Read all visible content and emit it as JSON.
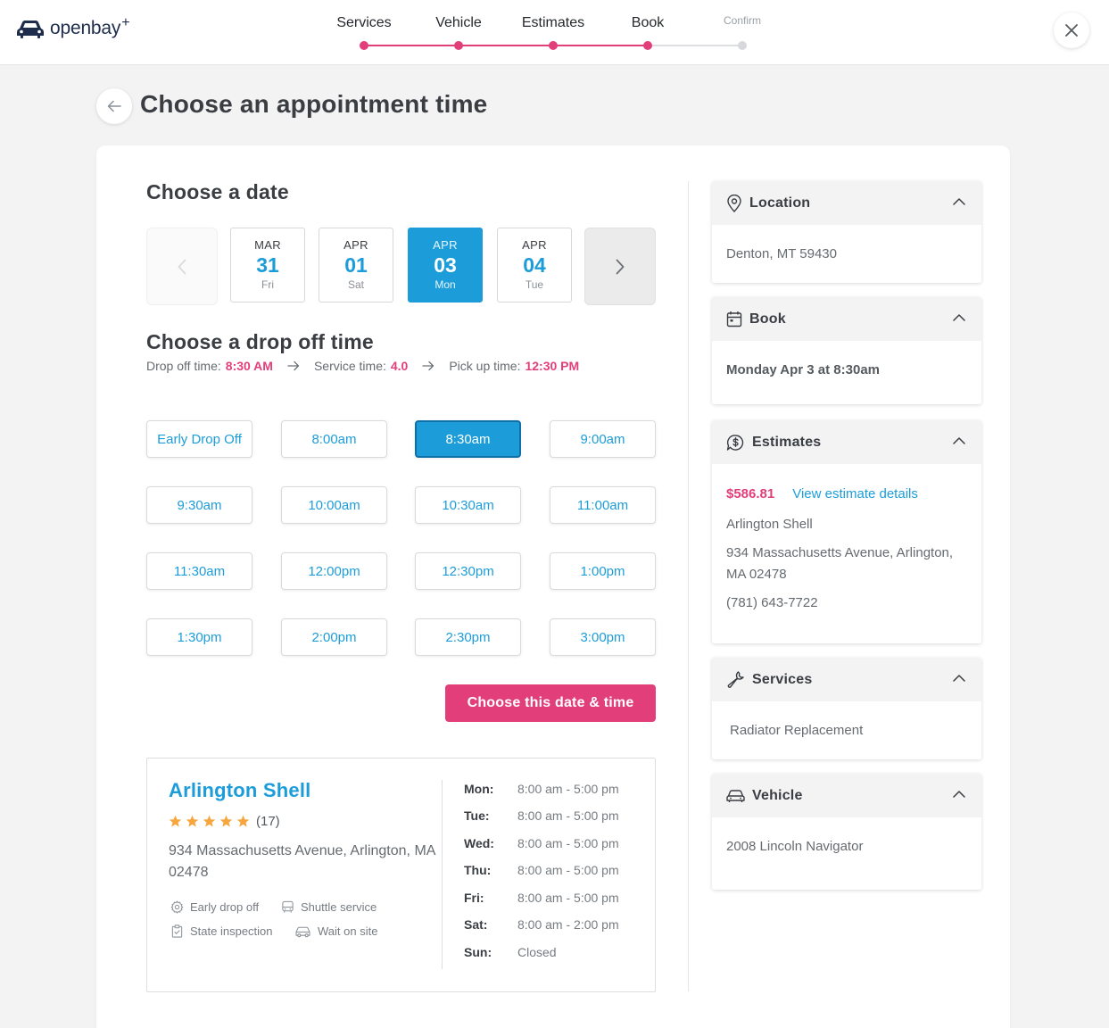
{
  "header": {
    "logo_text": "openbay",
    "logo_plus": "+",
    "steps": [
      {
        "label": "Services",
        "active": true
      },
      {
        "label": "Vehicle",
        "active": true
      },
      {
        "label": "Estimates",
        "active": true
      },
      {
        "label": "Book",
        "active": true
      },
      {
        "label": "Confirm",
        "active": false
      }
    ],
    "accent_color": "#e23f7a"
  },
  "page": {
    "title": "Choose an appointment time"
  },
  "date_section": {
    "heading": "Choose a date",
    "dates": [
      {
        "month": "MAR",
        "day": "31",
        "weekday": "Fri",
        "selected": false
      },
      {
        "month": "APR",
        "day": "01",
        "weekday": "Sat",
        "selected": false
      },
      {
        "month": "APR",
        "day": "03",
        "weekday": "Mon",
        "selected": true
      },
      {
        "month": "APR",
        "day": "04",
        "weekday": "Tue",
        "selected": false
      }
    ]
  },
  "time_section": {
    "heading": "Choose a drop off time",
    "drop_off_label": "Drop off time:",
    "drop_off_value": "8:30 AM",
    "service_label": "Service time:",
    "service_value": "4.0",
    "pickup_label": "Pick up time:",
    "pickup_value": "12:30 PM",
    "slots": [
      "Early Drop Off",
      "8:00am",
      "8:30am",
      "9:00am",
      "9:30am",
      "10:00am",
      "10:30am",
      "11:00am",
      "11:30am",
      "12:00pm",
      "12:30pm",
      "1:00pm",
      "1:30pm",
      "2:00pm",
      "2:30pm",
      "3:00pm"
    ],
    "selected_slot": "8:30am",
    "cta_label": "Choose this date & time"
  },
  "shop": {
    "name": "Arlington Shell",
    "rating": 5,
    "review_count": "(17)",
    "address": "934 Massachusetts Avenue, Arlington, MA 02478",
    "amenities": [
      {
        "icon": "gear-icon",
        "label": "Early drop off"
      },
      {
        "icon": "bus-icon",
        "label": "Shuttle service"
      },
      {
        "icon": "clipboard-check-icon",
        "label": "State inspection"
      },
      {
        "icon": "car-wait-icon",
        "label": "Wait on site"
      }
    ],
    "hours": [
      {
        "day": "Mon:",
        "hours": "8:00 am - 5:00 pm"
      },
      {
        "day": "Tue:",
        "hours": "8:00 am - 5:00 pm"
      },
      {
        "day": "Wed:",
        "hours": "8:00 am - 5:00 pm"
      },
      {
        "day": "Thu:",
        "hours": "8:00 am - 5:00 pm"
      },
      {
        "day": "Fri:",
        "hours": "8:00 am - 5:00 pm"
      },
      {
        "day": "Sat:",
        "hours": "8:00 am - 2:00 pm"
      },
      {
        "day": "Sun:",
        "hours": "Closed"
      }
    ]
  },
  "sidebar": {
    "location": {
      "title": "Location",
      "value": "Denton, MT 59430"
    },
    "book": {
      "title": "Book",
      "value": "Monday Apr 3 at 8:30am"
    },
    "estimates": {
      "title": "Estimates",
      "price": "$586.81",
      "link": "View estimate details",
      "shop_name": "Arlington Shell",
      "address": "934 Massachusetts Avenue, Arlington, MA 02478",
      "phone": "(781) 643-7722"
    },
    "services": {
      "title": "Services",
      "value": "Radiator Replacement"
    },
    "vehicle": {
      "title": "Vehicle",
      "value": "2008 Lincoln Navigator"
    }
  }
}
